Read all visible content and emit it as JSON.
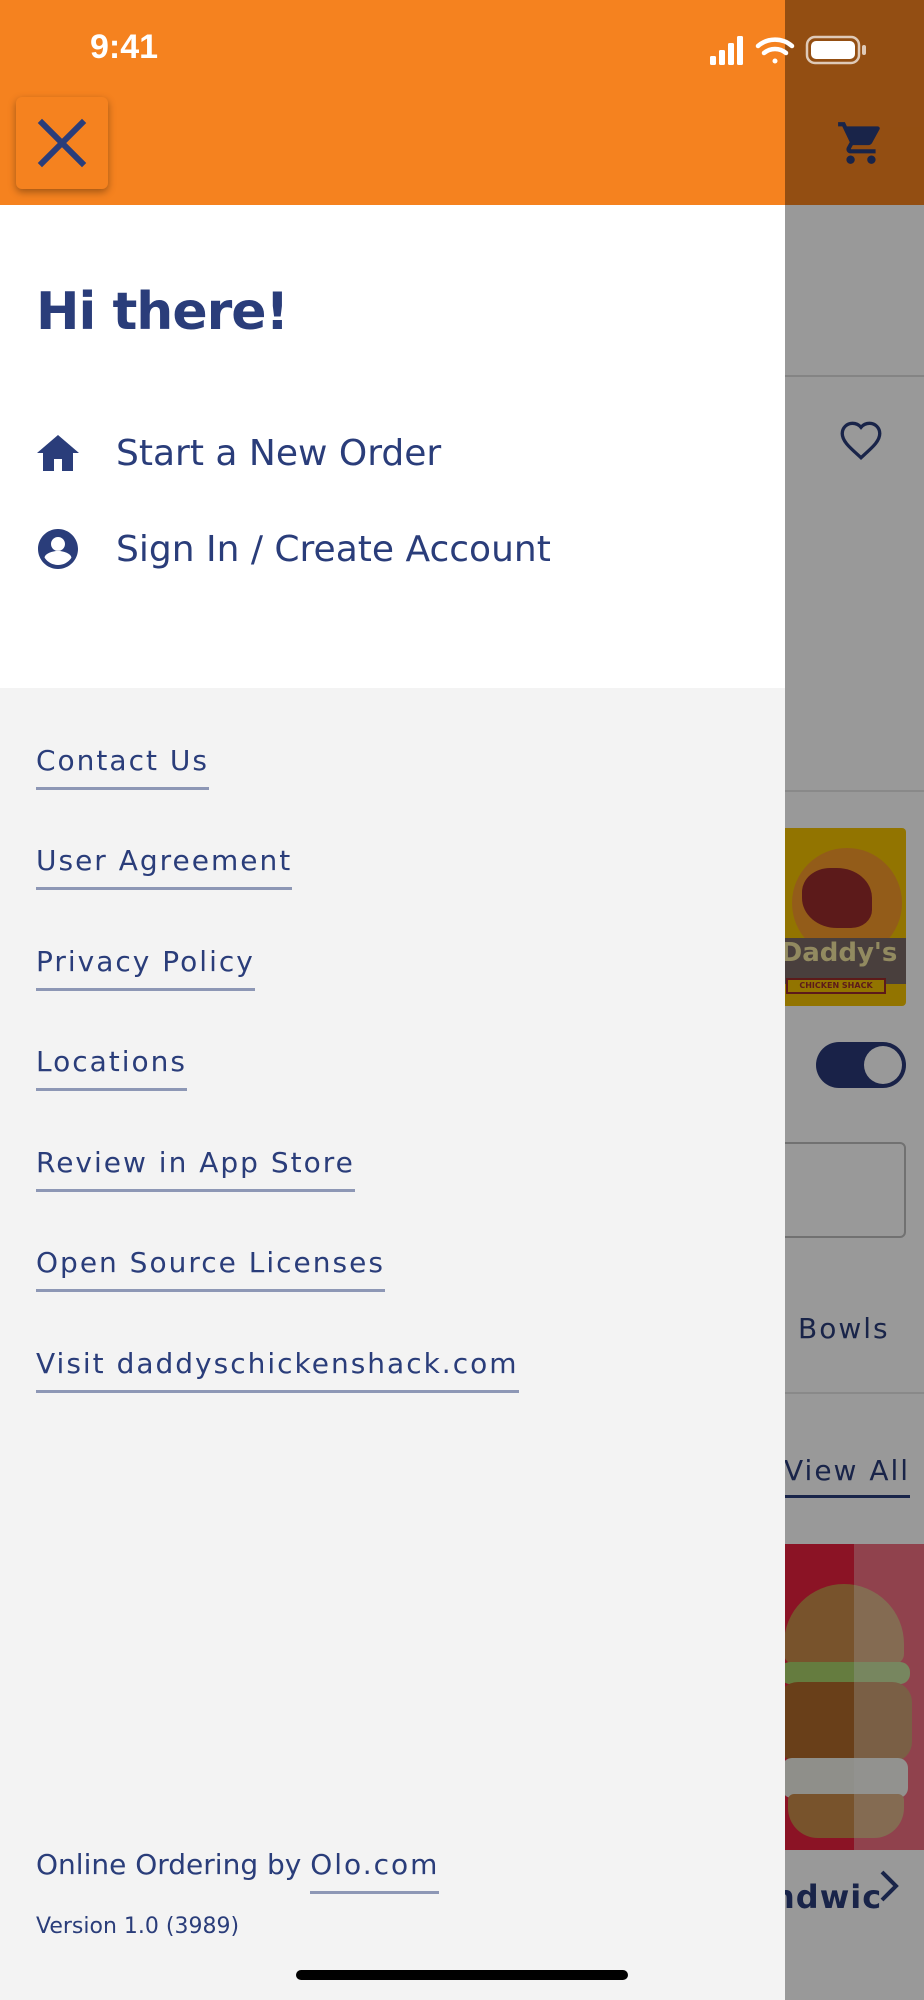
{
  "status_bar": {
    "time": "9:41"
  },
  "drawer": {
    "greeting": "Hi there!",
    "menu": [
      {
        "label": "Start a New Order",
        "icon": "home-icon"
      },
      {
        "label": "Sign In / Create Account",
        "icon": "account-circle-icon"
      }
    ],
    "links": [
      "Contact Us",
      "User Agreement",
      "Privacy Policy",
      "Locations",
      "Review in App Store",
      "Open Source Licenses",
      "Visit daddyschickenshack.com"
    ],
    "footer": {
      "prefix": "Online Ordering by ",
      "link": "Olo.com",
      "version": "Version 1.0 (3989)"
    }
  },
  "background": {
    "tab_partial": "Bowls",
    "view_all": "View All",
    "logo_text": "Daddy's",
    "logo_banner": "CHICKEN SHACK",
    "product_partial": "ndwic"
  },
  "colors": {
    "brand_orange": "#f5821f",
    "text_navy": "#2a3d7a",
    "link_underline": "#8d97b5",
    "drawer_bg": "#f3f3f3",
    "scrim": "rgba(0,0,0,0.40)"
  },
  "icons": [
    "close-icon",
    "cart-icon",
    "heart-icon",
    "home-icon",
    "account-circle-icon",
    "signal-icon",
    "wifi-icon",
    "battery-icon",
    "chevron-right-icon"
  ]
}
